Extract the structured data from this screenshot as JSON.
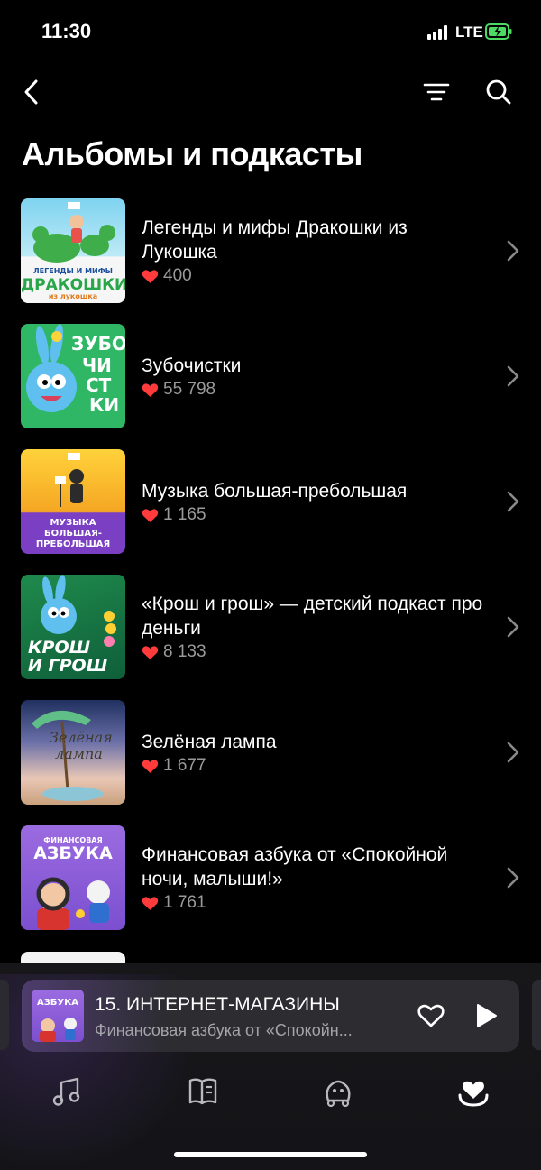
{
  "status_bar": {
    "time": "11:30",
    "network": "LTE"
  },
  "page": {
    "title": "Альбомы и подкасты"
  },
  "albums": [
    {
      "title": "Легенды и мифы Дракошки из Лукошка",
      "likes": "400",
      "cover_text": [
        "ЛЕГЕНДЫ И МИФЫ",
        "ДРАКОШКИ",
        "из лукошка"
      ]
    },
    {
      "title": "Зубочистки",
      "likes": "55 798",
      "cover_text": [
        "ЗУБО",
        "ЧИ",
        "СТ",
        "КИ"
      ]
    },
    {
      "title": "Музыка большая-пребольшая",
      "likes": "1 165",
      "cover_text": [
        "МУЗЫКА",
        "БОЛЬШАЯ-",
        "ПРЕБОЛЬШАЯ"
      ]
    },
    {
      "title": "«Крош и грош» — детский подкаст про деньги",
      "likes": "8 133",
      "cover_text": [
        "КРОШ",
        "И ГРОШ"
      ]
    },
    {
      "title": "Зелёная лампа",
      "likes": "1 677",
      "cover_text": [
        "Зелёная",
        "лампа"
      ]
    },
    {
      "title": "Финансовая азбука от «Спокойной ночи, малыши!»",
      "likes": "1 761",
      "cover_text": [
        "ФИНАНСОВАЯ",
        "АЗБУКА"
      ]
    }
  ],
  "player": {
    "track_title": "15. ИНТЕРНЕТ-МАГАЗИНЫ",
    "track_subtitle": "Финансовая азбука от «Спокойн...",
    "cover_text": "АЗБУКА"
  },
  "tabs": [
    "music-note-icon",
    "book-icon",
    "kids-icon",
    "collection-heart-icon"
  ],
  "colors": {
    "background": "#000000",
    "heart": "#ff3b3b",
    "secondary_text": "#9a9a9a",
    "player_bg": "#2c2c31"
  }
}
